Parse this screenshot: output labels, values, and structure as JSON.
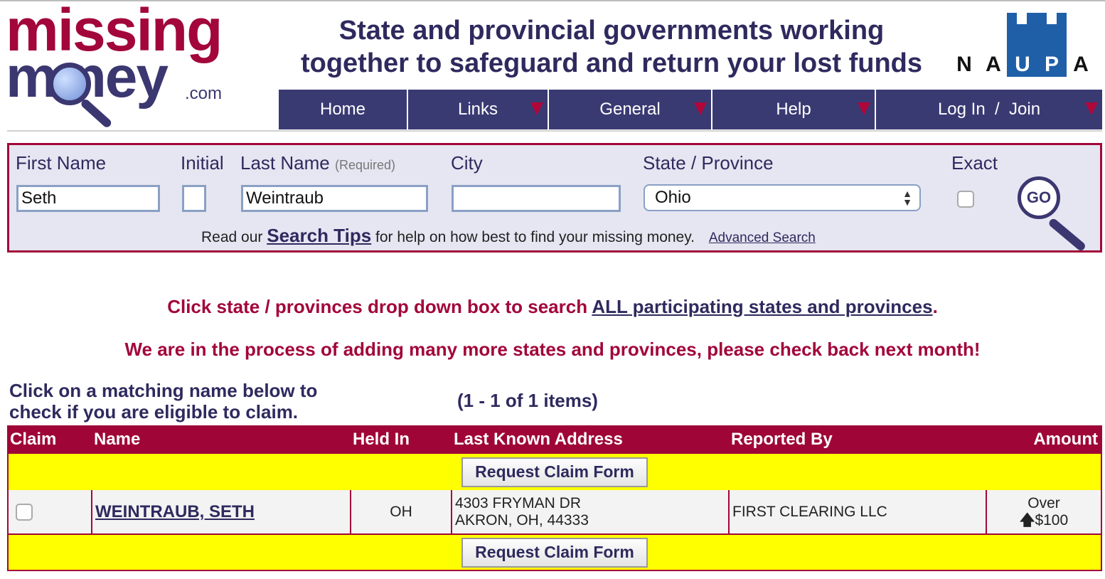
{
  "logo": {
    "line1": "missing",
    "line2": "m  ney",
    "suffix": ".com"
  },
  "tagline": {
    "line1": "State and provincial governments working",
    "line2": "together to safeguard and return your lost funds"
  },
  "naupa": {
    "letters": [
      "N",
      "A",
      "U",
      "P",
      "A"
    ]
  },
  "nav": {
    "items": [
      {
        "label": "Home"
      },
      {
        "label": "Links"
      },
      {
        "label": "General"
      },
      {
        "label": "Help"
      },
      {
        "label": "Log In  /  Join"
      }
    ]
  },
  "search": {
    "first_name_label": "First Name",
    "first_name_value": "Seth",
    "initial_label": "Initial",
    "initial_value": "",
    "last_name_label": "Last Name",
    "last_name_required": "(Required)",
    "last_name_value": "Weintraub",
    "city_label": "City",
    "city_value": "",
    "state_label": "State / Province",
    "state_value": "Ohio",
    "exact_label": "Exact",
    "go_label": "GO",
    "tips_prefix": "Read our ",
    "tips_link": "Search Tips",
    "tips_suffix": " for help on how best to find your missing money.",
    "advanced_link": "Advanced Search"
  },
  "notices": {
    "line1_prefix": "Click state / provinces drop down box to search ",
    "line1_link": "ALL participating states and provinces",
    "line1_suffix": ".",
    "line2": "We are in the process of adding many more states and provinces, please check back next month!"
  },
  "results": {
    "instruction": "Click on a matching name below to check if you are eligible to claim.",
    "count": "(1 - 1 of 1 items)",
    "headers": {
      "claim": "Claim",
      "name": "Name",
      "held_in": "Held In",
      "address": "Last Known Address",
      "reported_by": "Reported By",
      "amount": "Amount"
    },
    "request_button": "Request Claim Form",
    "rows": [
      {
        "name": "WEINTRAUB, SETH",
        "held_in": "OH",
        "address_line1": "4303 FRYMAN DR",
        "address_line2": "AKRON, OH, 44333",
        "reported_by": "FIRST CLEARING LLC",
        "amount_line1": "Over",
        "amount_line2": "$100"
      }
    ]
  },
  "colors": {
    "brand_red": "#a2063a",
    "brand_navy": "#3a3a73",
    "highlight_yellow": "#ffff00"
  }
}
